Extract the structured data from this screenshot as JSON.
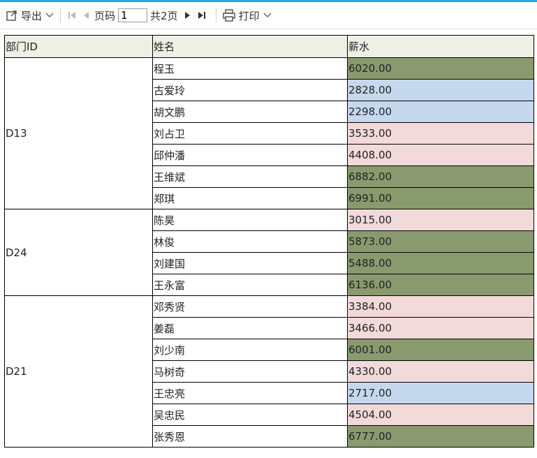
{
  "toolbar": {
    "export_label": "导出",
    "page_label": "页码",
    "page_value": "1",
    "total_pages": "共2页",
    "print_label": "打印"
  },
  "colors": {
    "accent_bar": "#2aa3ef",
    "header_bg": "#efefe6",
    "salary_high": "#8a9a6f",
    "salary_mid": "#f2d9da",
    "salary_low": "#c6d8ee"
  },
  "table": {
    "headers": [
      "部门ID",
      "姓名",
      "薪水"
    ],
    "groups": [
      {
        "dept": "D13",
        "rows": [
          {
            "name": "程玉",
            "salary": "6020.00",
            "level": "high"
          },
          {
            "name": "古爱玲",
            "salary": "2828.00",
            "level": "low"
          },
          {
            "name": "胡文鹏",
            "salary": "2298.00",
            "level": "low"
          },
          {
            "name": "刘占卫",
            "salary": "3533.00",
            "level": "mid"
          },
          {
            "name": "邱仲潘",
            "salary": "4408.00",
            "level": "mid"
          },
          {
            "name": "王维斌",
            "salary": "6882.00",
            "level": "high"
          },
          {
            "name": "郑琪",
            "salary": "6991.00",
            "level": "high"
          }
        ]
      },
      {
        "dept": "D24",
        "rows": [
          {
            "name": "陈昊",
            "salary": "3015.00",
            "level": "mid"
          },
          {
            "name": "林俊",
            "salary": "5873.00",
            "level": "high"
          },
          {
            "name": "刘建国",
            "salary": "5488.00",
            "level": "high"
          },
          {
            "name": "王永富",
            "salary": "6136.00",
            "level": "high"
          }
        ]
      },
      {
        "dept": "D21",
        "rows": [
          {
            "name": "邓秀贤",
            "salary": "3384.00",
            "level": "mid"
          },
          {
            "name": "姜磊",
            "salary": "3466.00",
            "level": "mid"
          },
          {
            "name": "刘少南",
            "salary": "6001.00",
            "level": "high"
          },
          {
            "name": "马树奇",
            "salary": "4330.00",
            "level": "mid"
          },
          {
            "name": "王忠亮",
            "salary": "2717.00",
            "level": "low"
          },
          {
            "name": "吴忠民",
            "salary": "4504.00",
            "level": "mid"
          },
          {
            "name": "张秀恩",
            "salary": "6777.00",
            "level": "high"
          }
        ]
      }
    ]
  }
}
